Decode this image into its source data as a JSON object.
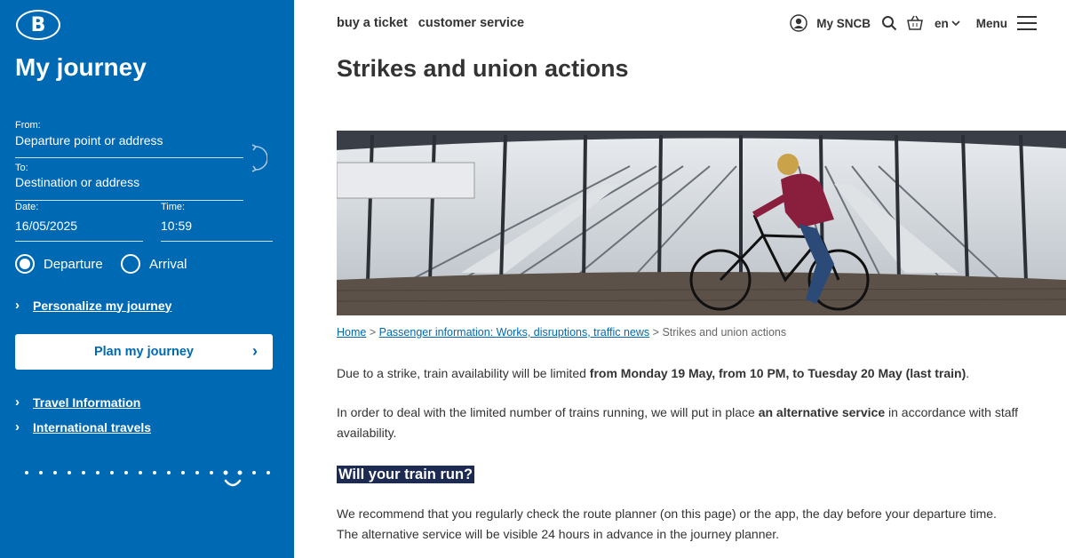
{
  "sidebar": {
    "logo_letter": "B",
    "title": "My journey",
    "from": {
      "label": "From:",
      "value": "Departure point or address"
    },
    "to": {
      "label": "To:",
      "value": "Destination or address"
    },
    "date": {
      "label": "Date:",
      "value": "16/05/2025"
    },
    "time": {
      "label": "Time:",
      "value": "10:59"
    },
    "radio_departure": "Departure",
    "radio_arrival": "Arrival",
    "personalize_link": "Personalize my journey",
    "plan_button": "Plan my journey",
    "travel_info_link": "Travel Information",
    "international_link": "International travels"
  },
  "header": {
    "nav": [
      "buy a ticket",
      "customer service"
    ],
    "my_sncb": "My SNCB",
    "language": "en",
    "menu": "Menu"
  },
  "main": {
    "title": "Strikes and union actions",
    "breadcrumb": {
      "home": "Home",
      "sep": ">",
      "passenger_info": "Passenger information: Works, disruptions, traffic news",
      "current": "Strikes and union actions"
    },
    "p1_start": "Due to a strike, train availability will be limited ",
    "p1_bold": "from Monday 19 May, from 10 PM, to Tuesday 20 May (last train)",
    "p1_end": ".",
    "p2_start": "In order to deal with the limited number of trains running, we will put in place ",
    "p2_bold": "an alternative service",
    "p2_end": " in accordance with staff availability.",
    "h2": "Will your train run?",
    "p3": "We recommend that you regularly check the route planner (on this page) or the app, the day before your departure time. The alternative service will be visible 24 hours in advance in the journey planner."
  },
  "colors": {
    "brand_blue": "#0069b4",
    "highlight_navy": "#1d2b53"
  },
  "icons": [
    "swap-icon",
    "user-icon",
    "search-icon",
    "basket-icon",
    "chevron-down-icon",
    "hamburger-icon",
    "chevron-right-icon"
  ]
}
